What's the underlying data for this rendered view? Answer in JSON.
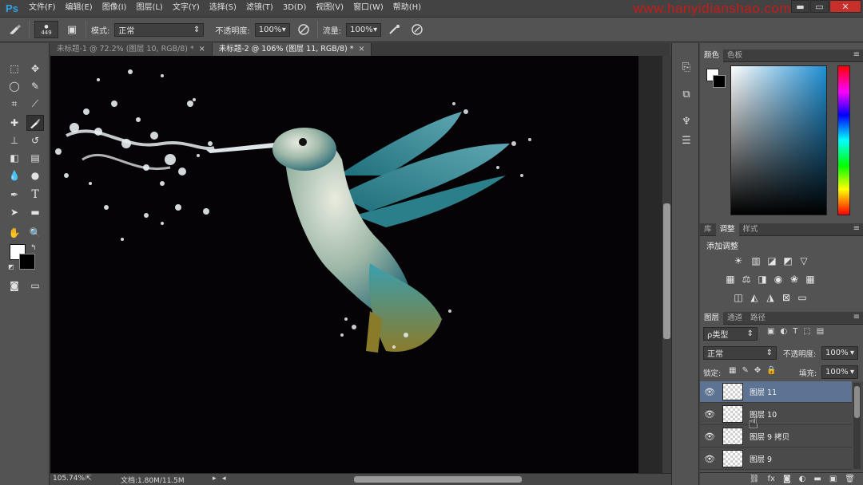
{
  "app": {
    "logo": "Ps",
    "watermark": "www.hanyidianshao.com"
  },
  "menu": [
    "文件(F)",
    "编辑(E)",
    "图像(I)",
    "图层(L)",
    "文字(Y)",
    "选择(S)",
    "滤镜(T)",
    "3D(D)",
    "视图(V)",
    "窗口(W)",
    "帮助(H)"
  ],
  "window_controls": {
    "minimize": "▬",
    "restore": "▭",
    "close": "✕"
  },
  "options": {
    "brush_size": "449",
    "mode_label": "模式:",
    "mode_value": "正常",
    "opacity_label": "不透明度:",
    "opacity_value": "100%",
    "flow_label": "流量:",
    "flow_value": "100%"
  },
  "tabs": [
    {
      "label": "未标题-1 @ 72.2% (图层 10, RGB/8) *",
      "close": "×"
    },
    {
      "label": "未标题-2 @ 106% (图层 11, RGB/8) *",
      "close": "×"
    }
  ],
  "status": {
    "zoom": "105.74%",
    "doc_info": "文档:1.80M/11.5M"
  },
  "color_panel": {
    "tabs": [
      "颜色",
      "色板"
    ]
  },
  "adjust_panel": {
    "tabs": [
      "库",
      "调整",
      "样式"
    ],
    "title": "添加调整"
  },
  "layers_panel": {
    "tabs": [
      "图层",
      "通道",
      "路径"
    ],
    "filter_label": "ρ类型",
    "blend_mode": "正常",
    "opacity_label": "不透明度:",
    "opacity_value": "100%",
    "lock_label": "锁定:",
    "fill_label": "填充:",
    "fill_value": "100%",
    "layers": [
      {
        "name": "图层 11",
        "selected": true
      },
      {
        "name": "图层 10",
        "selected": false
      },
      {
        "name": "图层 9 拷贝",
        "selected": false
      },
      {
        "name": "图层 9",
        "selected": false
      }
    ],
    "footer_icons": [
      "link-icon",
      "fx-icon",
      "mask-icon",
      "adjustment-icon",
      "group-icon",
      "new-layer-icon",
      "trash-icon"
    ]
  },
  "colors": {
    "accent": "#2fa3e6",
    "selected_layer": "#5d7393",
    "watermark": "#c91a1a"
  }
}
